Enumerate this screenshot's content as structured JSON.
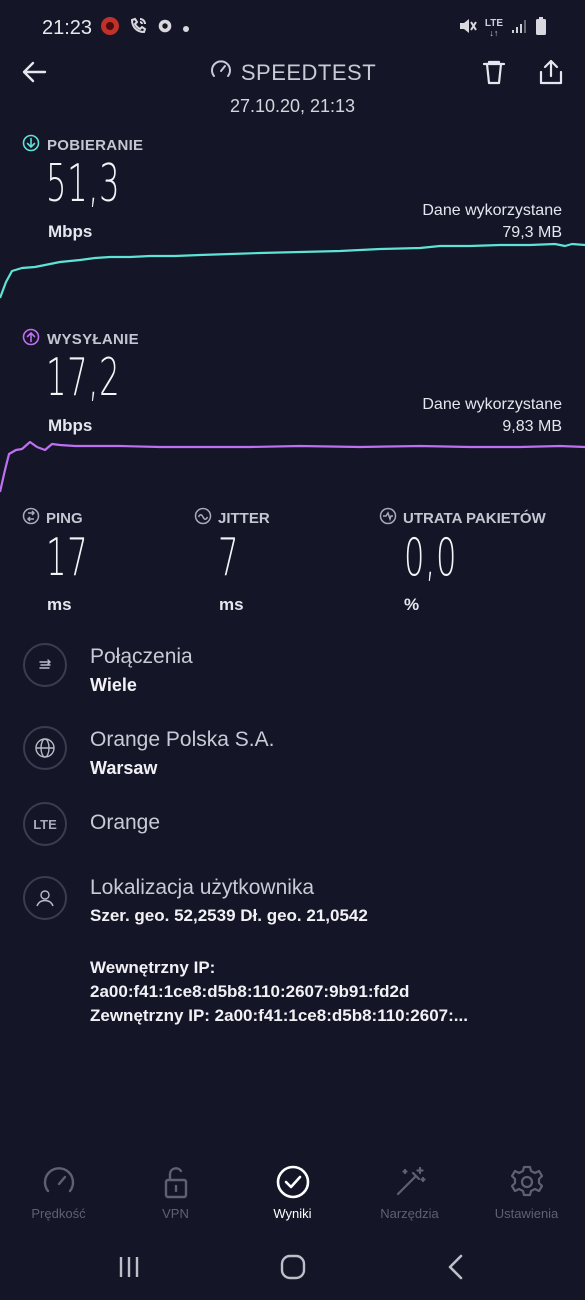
{
  "status_bar": {
    "time": "21:23",
    "network_label": "LTE",
    "icons": [
      "notification-app-icon",
      "wifi-calling-icon",
      "settings-icon",
      "dot-icon",
      "mute-icon",
      "lte-icon",
      "signal-icon",
      "battery-icon"
    ]
  },
  "header": {
    "title": "SPEEDTEST",
    "date": "27.10.20, 21:13",
    "icons": [
      "back-arrow-icon",
      "speedometer-icon",
      "trash-icon",
      "share-icon"
    ]
  },
  "download": {
    "label": "POBIERANIE",
    "value": "51,3",
    "unit": "Mbps",
    "data_used_label": "Dane wykorzystane",
    "data_used_value": "79,3 MB",
    "color": "#5ee3d6"
  },
  "upload": {
    "label": "WYSYŁANIE",
    "value": "17,2",
    "unit": "Mbps",
    "data_used_label": "Dane wykorzystane",
    "data_used_value": "9,83 MB",
    "color": "#bf6ff2"
  },
  "metrics": {
    "ping": {
      "label": "PING",
      "value": "17",
      "unit": "ms"
    },
    "jitter": {
      "label": "JITTER",
      "value": "7",
      "unit": "ms"
    },
    "packet_loss": {
      "label": "UTRATA PAKIETÓW",
      "value": "0,0",
      "unit": "%"
    }
  },
  "info": {
    "connections": {
      "title": "Połączenia",
      "subtitle": "Wiele"
    },
    "provider": {
      "title": "Orange Polska S.A.",
      "subtitle": "Warsaw"
    },
    "network": {
      "icon_text": "LTE",
      "title": "Orange"
    },
    "location": {
      "title": "Lokalizacja użytkownika",
      "coords": "Szer. geo. 52,2539 Dł. geo. 21,0542",
      "internal_ip_label": "Wewnętrzny IP:",
      "internal_ip": "2a00:f41:1ce8:d5b8:110:2607:9b91:fd2d",
      "external_ip": "Zewnętrzny IP: 2a00:f41:1ce8:d5b8:110:2607:..."
    }
  },
  "bottom_nav": [
    {
      "label": "Prędkość",
      "icon": "gauge-icon",
      "active": false
    },
    {
      "label": "VPN",
      "icon": "lock-icon",
      "active": false
    },
    {
      "label": "Wyniki",
      "icon": "check-circle-icon",
      "active": true
    },
    {
      "label": "Narzędzia",
      "icon": "magic-wand-icon",
      "active": false
    },
    {
      "label": "Ustawienia",
      "icon": "gear-icon",
      "active": false
    }
  ],
  "system_nav": [
    "recents-icon",
    "home-icon",
    "back-icon"
  ]
}
